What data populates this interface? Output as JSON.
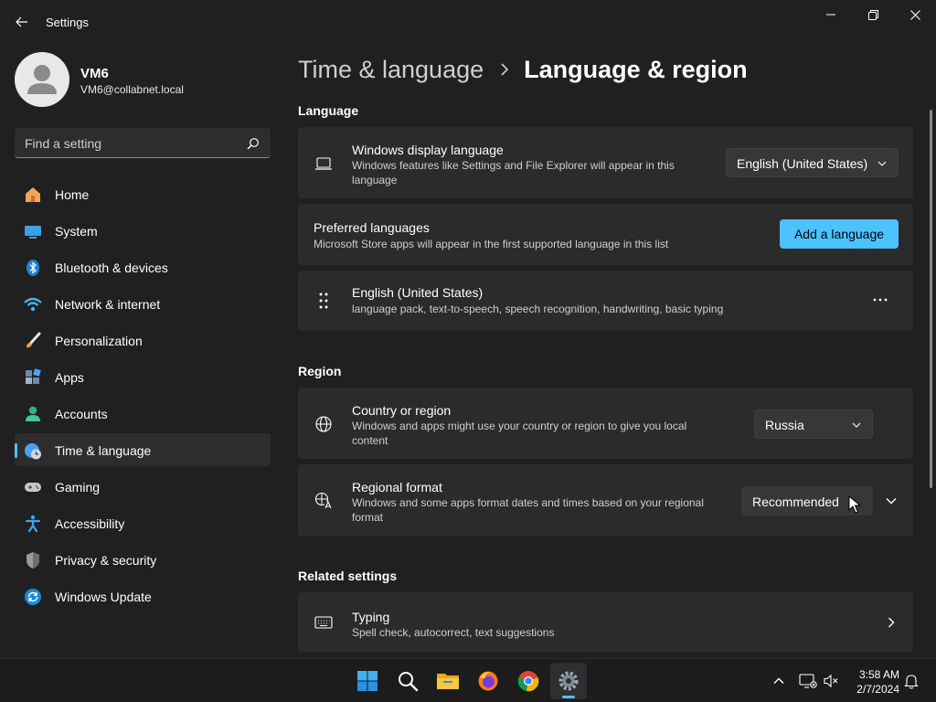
{
  "window": {
    "title": "Settings",
    "controls": {
      "minimize": "minimize",
      "restore": "restore",
      "close": "close"
    }
  },
  "profile": {
    "name": "VM6",
    "email": "VM6@collabnet.local"
  },
  "search": {
    "placeholder": "Find a setting"
  },
  "sidebar": {
    "items": [
      {
        "label": "Home",
        "icon": "home-icon",
        "active": false
      },
      {
        "label": "System",
        "icon": "system-icon",
        "active": false
      },
      {
        "label": "Bluetooth & devices",
        "icon": "bluetooth-icon",
        "active": false
      },
      {
        "label": "Network & internet",
        "icon": "wifi-icon",
        "active": false
      },
      {
        "label": "Personalization",
        "icon": "brush-icon",
        "active": false
      },
      {
        "label": "Apps",
        "icon": "apps-icon",
        "active": false
      },
      {
        "label": "Accounts",
        "icon": "accounts-icon",
        "active": false
      },
      {
        "label": "Time & language",
        "icon": "time-language-icon",
        "active": true
      },
      {
        "label": "Gaming",
        "icon": "gamepad-icon",
        "active": false
      },
      {
        "label": "Accessibility",
        "icon": "accessibility-icon",
        "active": false
      },
      {
        "label": "Privacy & security",
        "icon": "shield-icon",
        "active": false
      },
      {
        "label": "Windows Update",
        "icon": "update-icon",
        "active": false
      }
    ]
  },
  "breadcrumb": {
    "parent": "Time & language",
    "current": "Language & region"
  },
  "language_section": {
    "title": "Language",
    "display_language": {
      "title": "Windows display language",
      "description": "Windows features like Settings and File Explorer will appear in this language",
      "value": "English (United States)"
    },
    "preferred": {
      "title": "Preferred languages",
      "description": "Microsoft Store apps will appear in the first supported language in this list",
      "button": "Add a language"
    },
    "installed": {
      "title": "English (United States)",
      "description": "language pack, text-to-speech, speech recognition, handwriting, basic typing"
    }
  },
  "region_section": {
    "title": "Region",
    "country": {
      "title": "Country or region",
      "description": "Windows and apps might use your country or region to give you local content",
      "value": "Russia"
    },
    "format": {
      "title": "Regional format",
      "description": "Windows and some apps format dates and times based on your regional format",
      "value": "Recommended"
    }
  },
  "related_section": {
    "title": "Related settings",
    "typing": {
      "title": "Typing",
      "description": "Spell check, autocorrect, text suggestions"
    }
  },
  "taskbar": {
    "apps": [
      "start-icon",
      "search-icon",
      "file-explorer-icon",
      "firefox-icon",
      "chrome-icon",
      "settings-icon"
    ],
    "clock": {
      "time": "3:58 AM",
      "date": "2/7/2024"
    }
  },
  "colors": {
    "accent": "#4cc2ff",
    "background": "#202020",
    "card": "#2b2b2b"
  }
}
